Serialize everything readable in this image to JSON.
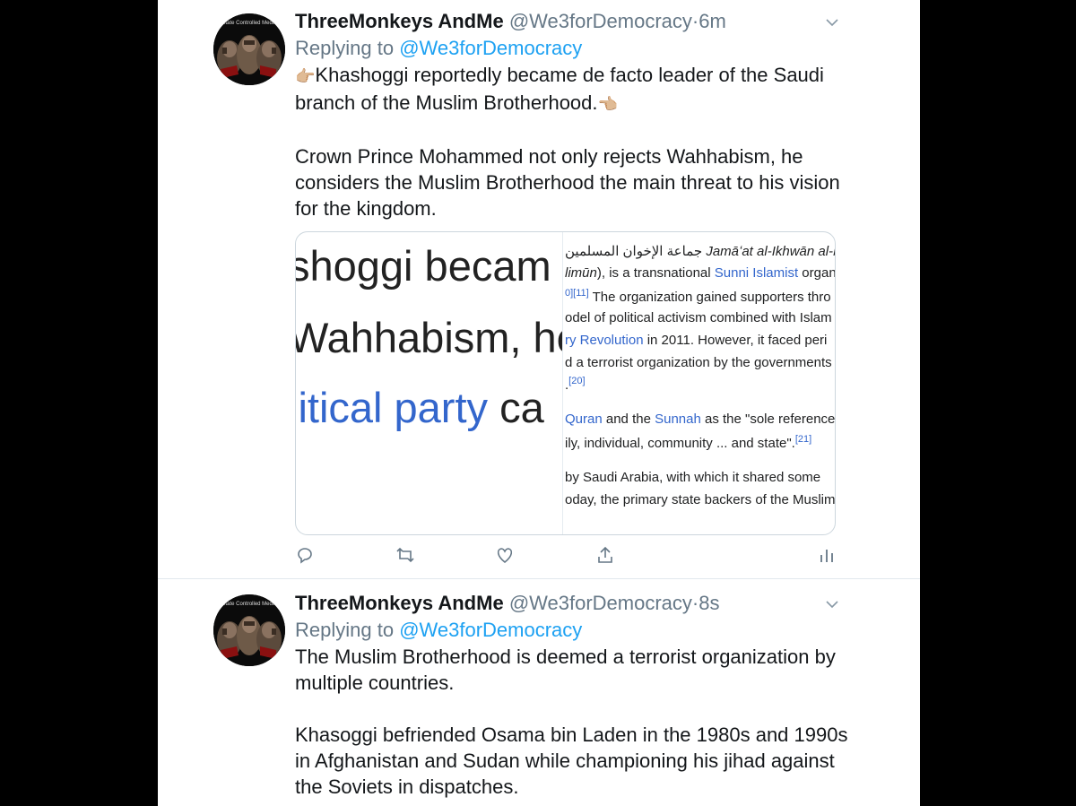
{
  "tweets": [
    {
      "name": "ThreeMonkeys AndMe",
      "handle": "@We3forDemocracy",
      "separator": "·",
      "time": "6m",
      "replying_prefix": "Replying to ",
      "replying_to": "@We3forDemocracy",
      "paragraphs": [
        "Khashoggi reportedly became de facto leader of the Saudi branch of the Muslim Brotherhood.",
        "Crown Prince Mohammed not only rejects Wahhabism, he considers the Muslim Brotherhood the main threat to his vision for the kingdom."
      ],
      "emoji_before": "👉🏼",
      "emoji_after": "👈🏼",
      "avatar_text": "State Controlled Media",
      "card": {
        "left_lines": [
          "shoggi becam",
          "Wahhabism, he",
          "litical party",
          "ca"
        ],
        "right_lines": [
          {
            "parts": [
              {
                "t": "جماعة الإخوان المسلمين ",
                "k": "ar"
              },
              {
                "t": "Jamāʻat al-Ikhwān al-Mus",
                "k": "it"
              }
            ]
          },
          {
            "parts": [
              {
                "t": "limūn",
                "k": "it"
              },
              {
                "t": "), is a transnational ",
                "k": "n"
              },
              {
                "t": "Sunni Islamist",
                "k": "l"
              },
              {
                "t": " organ",
                "k": "n"
              }
            ]
          },
          {
            "parts": [
              {
                "t": "0][11]",
                "k": "s"
              },
              {
                "t": " The organization gained supporters thro",
                "k": "n"
              }
            ]
          },
          {
            "parts": [
              {
                "t": "odel of political activism combined with Islam",
                "k": "n"
              }
            ]
          },
          {
            "parts": [
              {
                "t": "ry Revolution",
                "k": "l"
              },
              {
                "t": " in 2011. However, it faced peri",
                "k": "n"
              }
            ]
          },
          {
            "parts": [
              {
                "t": "d a terrorist organization by the governments",
                "k": "n"
              }
            ]
          },
          {
            "parts": [
              {
                "t": ".",
                "k": "n"
              },
              {
                "t": "[20]",
                "k": "s"
              }
            ]
          },
          {
            "parts": [
              {
                "t": "Quran",
                "k": "l"
              },
              {
                "t": " and the ",
                "k": "n"
              },
              {
                "t": "Sunnah",
                "k": "l"
              },
              {
                "t": " as the \"sole reference",
                "k": "n"
              }
            ]
          },
          {
            "parts": [
              {
                "t": "ily, individual, community ... and state\".",
                "k": "n"
              },
              {
                "t": "[21]",
                "k": "s"
              }
            ]
          },
          {
            "parts": [
              {
                "t": " by Saudi Arabia, with which it shared some",
                "k": "n"
              }
            ]
          },
          {
            "parts": [
              {
                "t": "oday, the primary state backers of the Muslim",
                "k": "n"
              }
            ]
          }
        ]
      }
    },
    {
      "name": "ThreeMonkeys AndMe",
      "handle": "@We3forDemocracy",
      "separator": "·",
      "time": "8s",
      "replying_prefix": "Replying to ",
      "replying_to": "@We3forDemocracy",
      "paragraphs": [
        "The Muslim Brotherhood is deemed a terrorist organization by multiple countries.",
        "Khasoggi befriended Osama bin Laden in the 1980s and 1990s in Afghanistan and Sudan while championing his jihad against the Soviets in dispatches."
      ],
      "avatar_text": "State Controlled Media"
    }
  ],
  "icons": {
    "reply": "reply-icon",
    "retweet": "retweet-icon",
    "like": "heart-icon",
    "share": "share-icon",
    "analytics": "analytics-icon",
    "more": "chevron-down-icon"
  },
  "colors": {
    "link": "#1da1f2",
    "secondary_text": "#657786",
    "wiki_link": "#3366cc",
    "background": "#000000"
  }
}
